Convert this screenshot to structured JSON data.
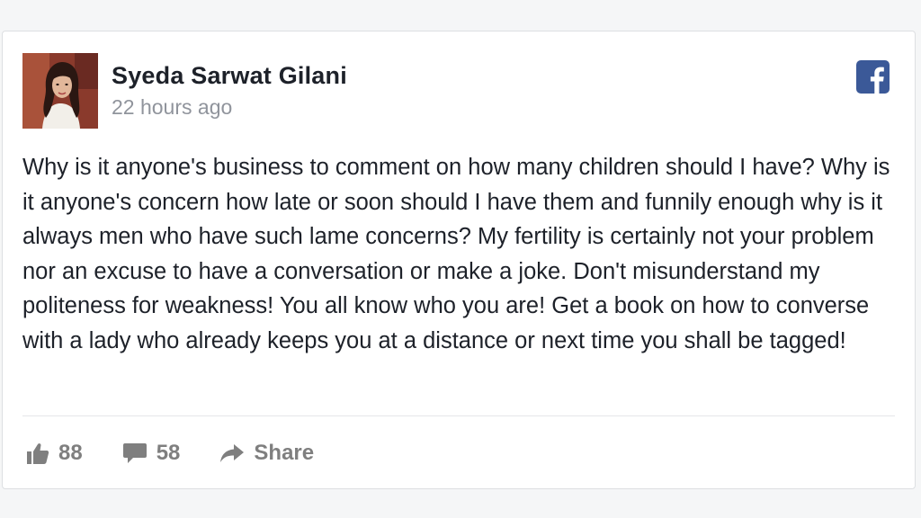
{
  "post": {
    "author": "Syeda Sarwat Gilani",
    "timestamp": "22 hours ago",
    "body": "Why is it anyone's business to comment on how many children should I have? Why is it anyone's concern how late or soon should I have them and funnily enough why is it always men who have such lame concerns? My fertility is certainly not your problem nor an excuse to have a conversation or make a joke. Don't misunderstand my politeness for weakness! You all know who you are! Get a book on how to converse with a lady who already keeps you at a distance or next time you shall be tagged!",
    "source_icon": "facebook-icon"
  },
  "actions": {
    "likes": "88",
    "comments": "58",
    "share_label": "Share"
  },
  "colors": {
    "facebook_blue": "#3b5998",
    "text": "#1d2129",
    "muted": "#90949c",
    "action_gray": "#7f7f7f"
  }
}
